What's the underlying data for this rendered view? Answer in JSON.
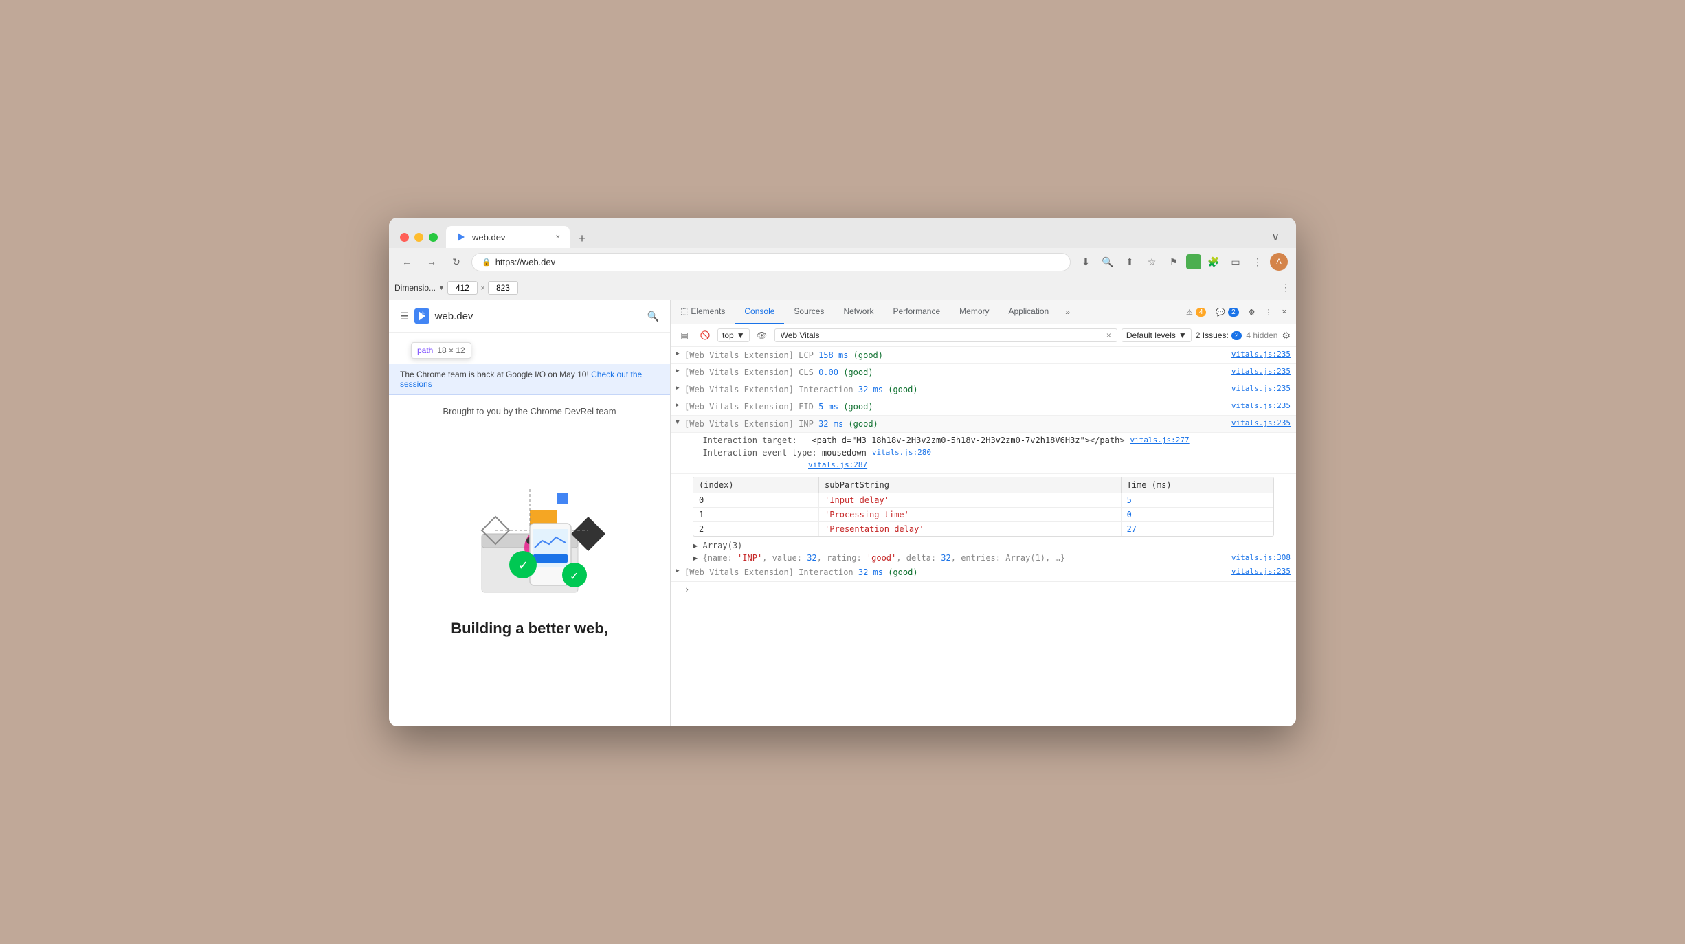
{
  "browser": {
    "traffic_lights": [
      "red",
      "yellow",
      "green"
    ],
    "tab": {
      "favicon": "▶",
      "title": "web.dev",
      "close": "×"
    },
    "new_tab": "+",
    "menu_btn": "∨",
    "address": "https://web.dev",
    "toolbar_icons": [
      "download",
      "zoom",
      "share",
      "star",
      "flag",
      "green",
      "puzzle",
      "sidebar",
      "more",
      "avatar"
    ]
  },
  "devtools_toolbar": {
    "dimension_label": "Dimensio...",
    "width": "412",
    "x": "×",
    "height": "823",
    "more": "⋮"
  },
  "webpage": {
    "logo_text": "web.dev",
    "banner_text": "The Chrome team is back at Google I/O on May 10!",
    "banner_link": "Check out the sessions",
    "credit": "Brought to you by the Chrome DevRel team",
    "path_tooltip_label": "path",
    "path_tooltip_dims": "18 × 12",
    "hero_title": "Building a better web,"
  },
  "devtools": {
    "tabs": [
      "Elements",
      "Console",
      "Sources",
      "Network",
      "Performance",
      "Memory",
      "Application"
    ],
    "active_tab": "Console",
    "more_tabs": "»",
    "badge_warning_count": "4",
    "badge_info_count": "2",
    "settings_label": "⚙",
    "more_options": "⋮",
    "close": "×"
  },
  "console_toolbar": {
    "clear_btn": "🚫",
    "filter_placeholder": "Web Vitals",
    "filter_value": "Web Vitals",
    "context": "top",
    "eye_btn": "👁",
    "levels_label": "Default levels",
    "issues_label": "2 Issues:",
    "issues_count": "2",
    "hidden_count": "4 hidden",
    "settings_icon": "⚙"
  },
  "console_entries": [
    {
      "id": 1,
      "expandable": true,
      "expanded": false,
      "text": "[Web Vitals Extension] LCP ",
      "value": "158 ms",
      "value_color": "blue",
      "suffix": " (good)",
      "suffix_color": "green",
      "source": "vitals.js:235"
    },
    {
      "id": 2,
      "expandable": true,
      "expanded": false,
      "text": "[Web Vitals Extension] CLS ",
      "value": "0.00",
      "value_color": "blue",
      "suffix": " (good)",
      "suffix_color": "green",
      "source": "vitals.js:235"
    },
    {
      "id": 3,
      "expandable": true,
      "expanded": false,
      "text": "[Web Vitals Extension] Interaction ",
      "value": "32 ms",
      "value_color": "blue",
      "suffix": " (good)",
      "suffix_color": "green",
      "source": "vitals.js:235"
    },
    {
      "id": 4,
      "expandable": true,
      "expanded": false,
      "text": "[Web Vitals Extension] FID ",
      "value": "5 ms",
      "value_color": "blue",
      "suffix": " (good)",
      "suffix_color": "green",
      "source": "vitals.js:235"
    },
    {
      "id": 5,
      "expandable": true,
      "expanded": true,
      "text": "[Web Vitals Extension] INP ",
      "value": "32 ms",
      "value_color": "blue",
      "suffix": " (good)",
      "suffix_color": "green",
      "source": "vitals.js:235"
    }
  ],
  "expanded_inp": {
    "interaction_target_label": "Interaction target:",
    "interaction_target_value": "<path d=\"M3 18h18v-2H3v2zm0-5h18v-2H3v2zm0-7v2h18V6H3z\"></path>",
    "interaction_event_label": "Interaction event type:",
    "interaction_event_value": "mousedown",
    "source_277": "vitals.js:277",
    "source_280": "vitals.js:280",
    "source_287": "vitals.js:287"
  },
  "console_table": {
    "headers": [
      "(index)",
      "subPartString",
      "Time (ms)"
    ],
    "rows": [
      {
        "index": "0",
        "subpart": "'Input delay'",
        "time": "5"
      },
      {
        "index": "1",
        "subpart": "'Processing time'",
        "time": "0"
      },
      {
        "index": "2",
        "subpart": "'Presentation delay'",
        "time": "27"
      }
    ]
  },
  "array_entry": "▶ Array(3)",
  "object_entry": "▶ {name: 'INP', value: 32, rating: 'good', delta: 32, entries: Array(1), …}",
  "object_source": "vitals.js:308",
  "last_entry": {
    "text": "[Web Vitals Extension] Interaction ",
    "value": "32 ms",
    "value_color": "blue",
    "suffix": " (good)",
    "suffix_color": "green",
    "source": "vitals.js:235"
  }
}
